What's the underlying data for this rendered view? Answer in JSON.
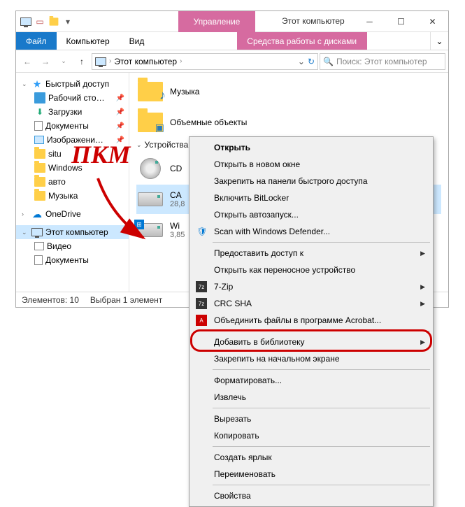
{
  "titlebar": {
    "context_tab": "Управление",
    "title": "Этот компьютер"
  },
  "ribbon": {
    "file": "Файл",
    "main": "Компьютер",
    "view": "Вид",
    "context": "Средства работы с дисками"
  },
  "address": {
    "root": "Этот компьютер",
    "search_placeholder": "Поиск: Этот компьютер"
  },
  "sidebar": {
    "quick": "Быстрый доступ",
    "quick_items": [
      "Рабочий сто…",
      "Загрузки",
      "Документы",
      "Изображени…",
      "situ",
      "Windows",
      "авто",
      "Музыка"
    ],
    "onedrive": "OneDrive",
    "thispc": "Этот компьютер",
    "thispc_items": [
      "Видео",
      "Документы"
    ]
  },
  "content": {
    "group_devices": "Устройства и",
    "folders": [
      {
        "name": "Музыка"
      },
      {
        "name": "Объемные объекты"
      }
    ],
    "drives": [
      {
        "name": "CD",
        "meta": ""
      },
      {
        "name": "CA",
        "meta": "28,8"
      },
      {
        "name": "Wi",
        "meta": "3,85"
      }
    ]
  },
  "statusbar": {
    "count": "Элементов: 10",
    "selection": "Выбран 1 элемент"
  },
  "context_menu": {
    "items": [
      {
        "label": "Открыть",
        "bold": true
      },
      {
        "label": "Открыть в новом окне"
      },
      {
        "label": "Закрепить на панели быстрого доступа"
      },
      {
        "label": "Включить BitLocker"
      },
      {
        "label": "Открыть автозапуск..."
      },
      {
        "label": "Scan with Windows Defender...",
        "icon": "shield"
      },
      {
        "sep": true
      },
      {
        "label": "Предоставить доступ к",
        "submenu": true
      },
      {
        "label": "Открыть как переносное устройство"
      },
      {
        "label": "7-Zip",
        "submenu": true,
        "icon": "7z"
      },
      {
        "label": "CRC SHA",
        "submenu": true,
        "icon": "7z"
      },
      {
        "label": "Объединить файлы в программе Acrobat...",
        "icon": "pdf"
      },
      {
        "sep": true
      },
      {
        "label": "Добавить в библиотеку",
        "submenu": true
      },
      {
        "label": "Закрепить на начальном экране"
      },
      {
        "sep": true
      },
      {
        "label": "Форматировать...",
        "highlight": true
      },
      {
        "label": "Извлечь"
      },
      {
        "sep": true
      },
      {
        "label": "Вырезать"
      },
      {
        "label": "Копировать"
      },
      {
        "sep": true
      },
      {
        "label": "Создать ярлык"
      },
      {
        "label": "Переименовать"
      },
      {
        "sep": true
      },
      {
        "label": "Свойства"
      }
    ]
  },
  "annotation": {
    "label": "ПКМ"
  }
}
